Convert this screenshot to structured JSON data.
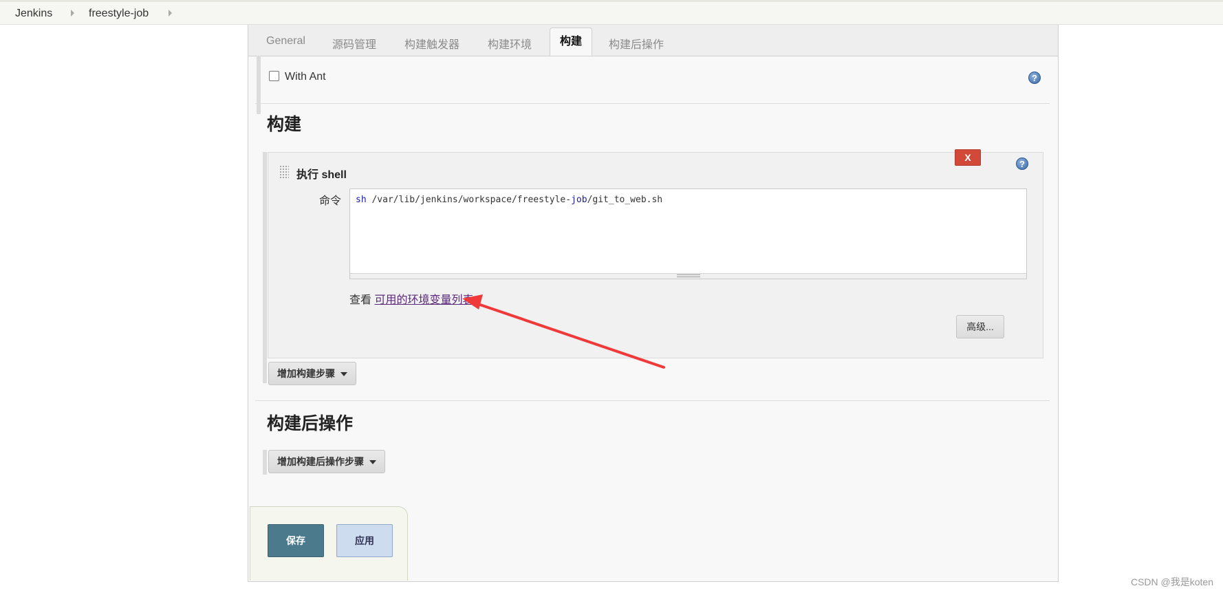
{
  "breadcrumb": {
    "items": [
      "Jenkins",
      "freestyle-job"
    ]
  },
  "tabs": [
    "General",
    "源码管理",
    "构建触发器",
    "构建环境",
    "构建",
    "构建后操作"
  ],
  "active_tab": "构建",
  "prev_section": {
    "checkbox_label": "With Ant",
    "checked": false
  },
  "build": {
    "title": "构建",
    "step_title": "执行 shell",
    "delete_label": "X",
    "command_label": "命令",
    "command_parts": [
      "sh",
      " /var/lib/jenkins/workspace/freestyle-",
      "job",
      "/git_to_web.sh"
    ],
    "env_prefix": "查看 ",
    "env_link": "可用的环境变量列表",
    "advanced_label": "高级...",
    "add_step_label": "增加构建步骤"
  },
  "post_build": {
    "title": "构建后操作",
    "add_step_label": "增加构建后操作步骤"
  },
  "actions": {
    "save_label": "保存",
    "apply_label": "应用"
  },
  "help_icon_glyph": "?",
  "watermark": "CSDN @我是koten",
  "colors": {
    "delete_red": "#d24939",
    "save_blue": "#4a7a8c",
    "apply_blue": "#cddcee",
    "annotation_arrow": "#f03a3a"
  }
}
